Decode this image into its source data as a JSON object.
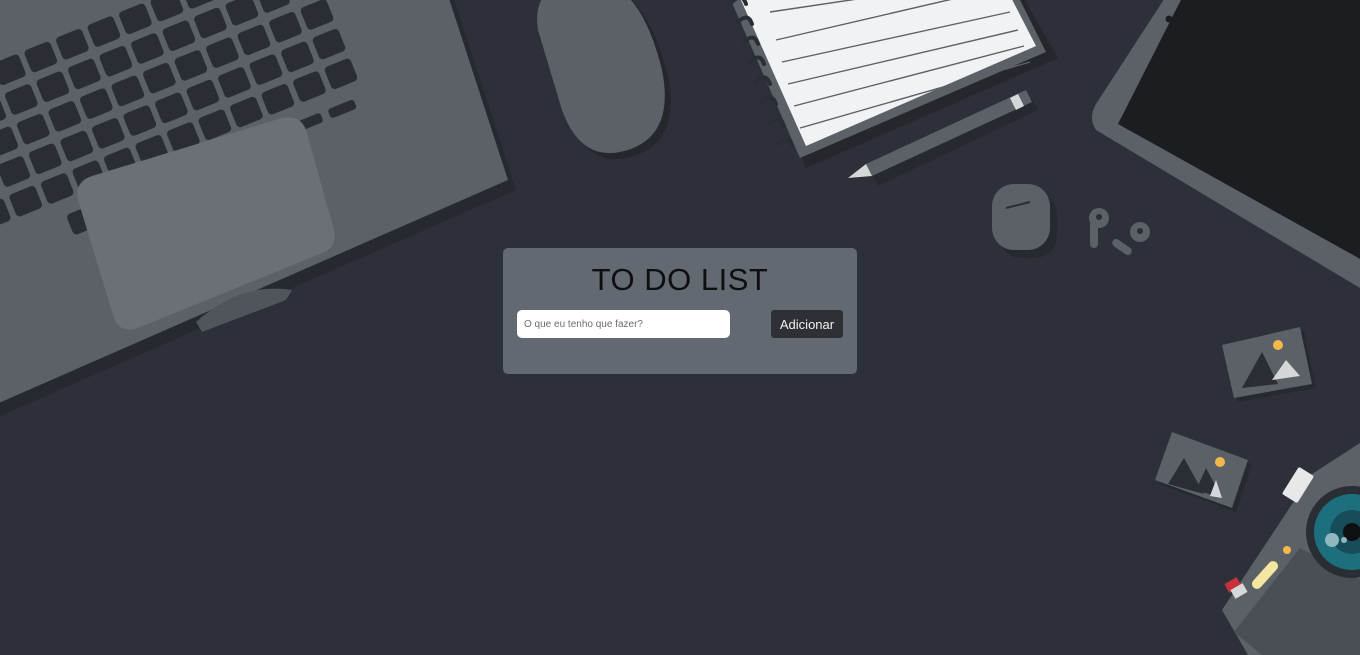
{
  "app": {
    "title": "TO DO LIST"
  },
  "form": {
    "input_placeholder": "O que eu tenho que fazer?",
    "input_value": "",
    "add_button_label": "Adicionar"
  },
  "colors": {
    "background": "#2d3038",
    "card": "#636970",
    "button": "#2e3035",
    "device_gray": "#5c6167",
    "accent_yellow": "#f2b84b",
    "accent_red": "#c9313a",
    "lens_teal": "#1d6f7e"
  },
  "illustration": {
    "icons": [
      "laptop-icon",
      "mouse-icon",
      "notebook-icon",
      "pencil-icon",
      "tablet-icon",
      "earbuds-case-icon",
      "earbuds-icon",
      "photo-icon",
      "camera-icon"
    ]
  }
}
